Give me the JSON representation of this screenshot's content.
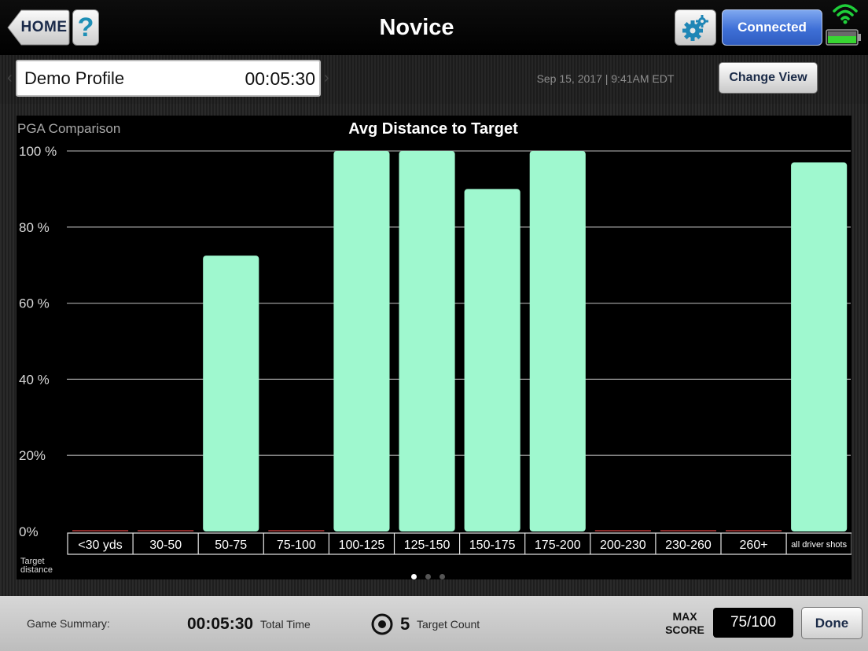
{
  "header": {
    "home_label": "HOME",
    "help_label": "?",
    "title": "Novice",
    "gear_icon": "gear-icon",
    "connection_label": "Connected",
    "wifi_icon": "wifi-icon",
    "battery_icon": "battery-icon"
  },
  "profile": {
    "name": "Demo Profile",
    "timer": "00:05:30",
    "datetime": "Sep 15, 2017 | 9:41AM EDT",
    "change_view_label": "Change View"
  },
  "chart_data": {
    "type": "bar",
    "title": "Avg Distance to Target",
    "top_left_label": "PGA Comparison",
    "xlabel": "Target distance",
    "categories": [
      "<30 yds",
      "30-50",
      "50-75",
      "75-100",
      "100-125",
      "125-150",
      "150-175",
      "175-200",
      "200-230",
      "230-260",
      "260+",
      "all driver shots"
    ],
    "values": [
      0,
      0,
      72.5,
      0,
      100,
      100,
      90,
      100,
      0,
      0,
      0,
      97
    ],
    "ylim": [
      0,
      100
    ],
    "yticks": [
      {
        "value": 100,
        "label": "100 %"
      },
      {
        "value": 80,
        "label": "80 %"
      },
      {
        "value": 60,
        "label": "60 %"
      },
      {
        "value": 40,
        "label": "40 %"
      },
      {
        "value": 20,
        "label": "20%"
      },
      {
        "value": 0,
        "label": "0%"
      }
    ],
    "grid": true,
    "bar_color": "#9ff8cf",
    "zero_marker_color": "#8a2a2a"
  },
  "pager": {
    "count": 3,
    "active": 0
  },
  "footer": {
    "summary_label": "Game Summary:",
    "total_time_value": "00:05:30",
    "total_time_label": "Total Time",
    "target_icon": "target-icon",
    "target_count_value": "5",
    "target_count_label": "Target Count",
    "max_score_line1": "MAX",
    "max_score_line2": "SCORE",
    "score_value": "75/100",
    "done_label": "Done"
  }
}
